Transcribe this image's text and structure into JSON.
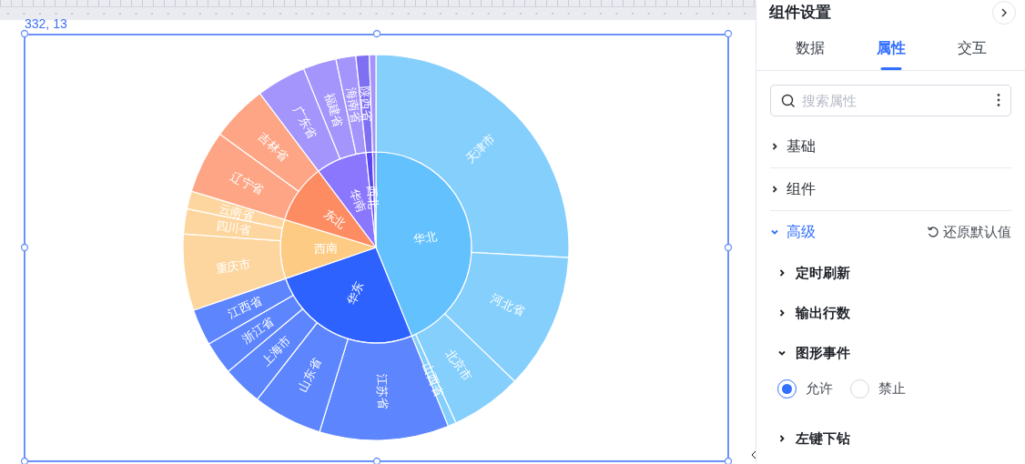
{
  "canvas": {
    "position_label": "332, 13",
    "chart": {
      "regions": [
        {
          "label": "华北",
          "color": "#63c2fd",
          "children": [
            {
              "label": "天津市"
            },
            {
              "label": "河北省"
            },
            {
              "label": "北京市"
            },
            {
              "label": "山西省"
            }
          ]
        },
        {
          "label": "华东",
          "color": "#2e62fe",
          "children": [
            {
              "label": "江苏省"
            },
            {
              "label": "山东省"
            },
            {
              "label": "上海市"
            },
            {
              "label": "浙江省"
            },
            {
              "label": "江西省"
            }
          ]
        },
        {
          "label": "西南",
          "color": "#fdcb84",
          "children": [
            {
              "label": "重庆市"
            },
            {
              "label": "四川省"
            },
            {
              "label": "云南省"
            }
          ]
        },
        {
          "label": "东北",
          "color": "#fd8c62",
          "children": [
            {
              "label": "辽宁省"
            },
            {
              "label": "吉林省"
            }
          ]
        },
        {
          "label": "华南",
          "color": "#8a77fd",
          "children": [
            {
              "label": "广东省"
            },
            {
              "label": "福建省"
            },
            {
              "label": "海南省"
            }
          ]
        },
        {
          "label": "西北",
          "color": "#5b47f0",
          "children": [
            {
              "label": "陕西省"
            }
          ]
        },
        {
          "color": "#8a77fd"
        }
      ]
    }
  },
  "panel": {
    "title": "组件设置",
    "tabs": [
      {
        "label": "数据",
        "selected": false
      },
      {
        "label": "属性",
        "selected": true
      },
      {
        "label": "交互",
        "selected": false
      }
    ],
    "search": {
      "placeholder": "搜索属性"
    },
    "sections": [
      {
        "label": "基础",
        "expanded": false
      },
      {
        "label": "组件",
        "expanded": false
      },
      {
        "label": "高级",
        "expanded": true,
        "action": "还原默认值",
        "children": [
          {
            "label": "定时刷新",
            "expanded": false
          },
          {
            "label": "输出行数",
            "expanded": false
          },
          {
            "label": "图形事件",
            "expanded": true,
            "options": [
              {
                "label": "允许",
                "selected": true
              },
              {
                "label": "禁止",
                "selected": false
              }
            ]
          },
          {
            "label": "左键下钻",
            "expanded": false
          }
        ]
      }
    ]
  }
}
